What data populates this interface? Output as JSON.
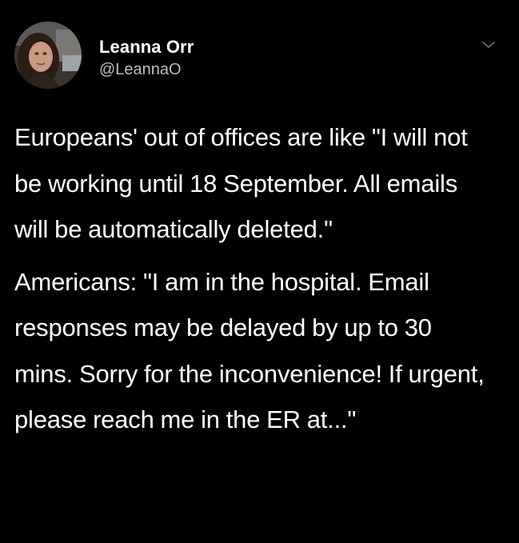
{
  "tweet": {
    "author": {
      "display_name": "Leanna Orr",
      "handle": "@LeannaO",
      "avatar_icon": "profile-photo"
    },
    "menu_icon": "chevron-down-icon",
    "paragraphs": [
      "Europeans' out of offices are like \"I will not be working until 18 September. All emails will be automatically deleted.\"",
      "Americans: \"I am in the hospital. Email responses may be delayed by up to 30 mins. Sorry for the inconvenience! If urgent, please reach me in the ER at...\""
    ]
  },
  "colors": {
    "background": "#000000",
    "text_primary": "#ffffff",
    "text_secondary": "#b9bfc5",
    "chevron": "#6e767d"
  }
}
